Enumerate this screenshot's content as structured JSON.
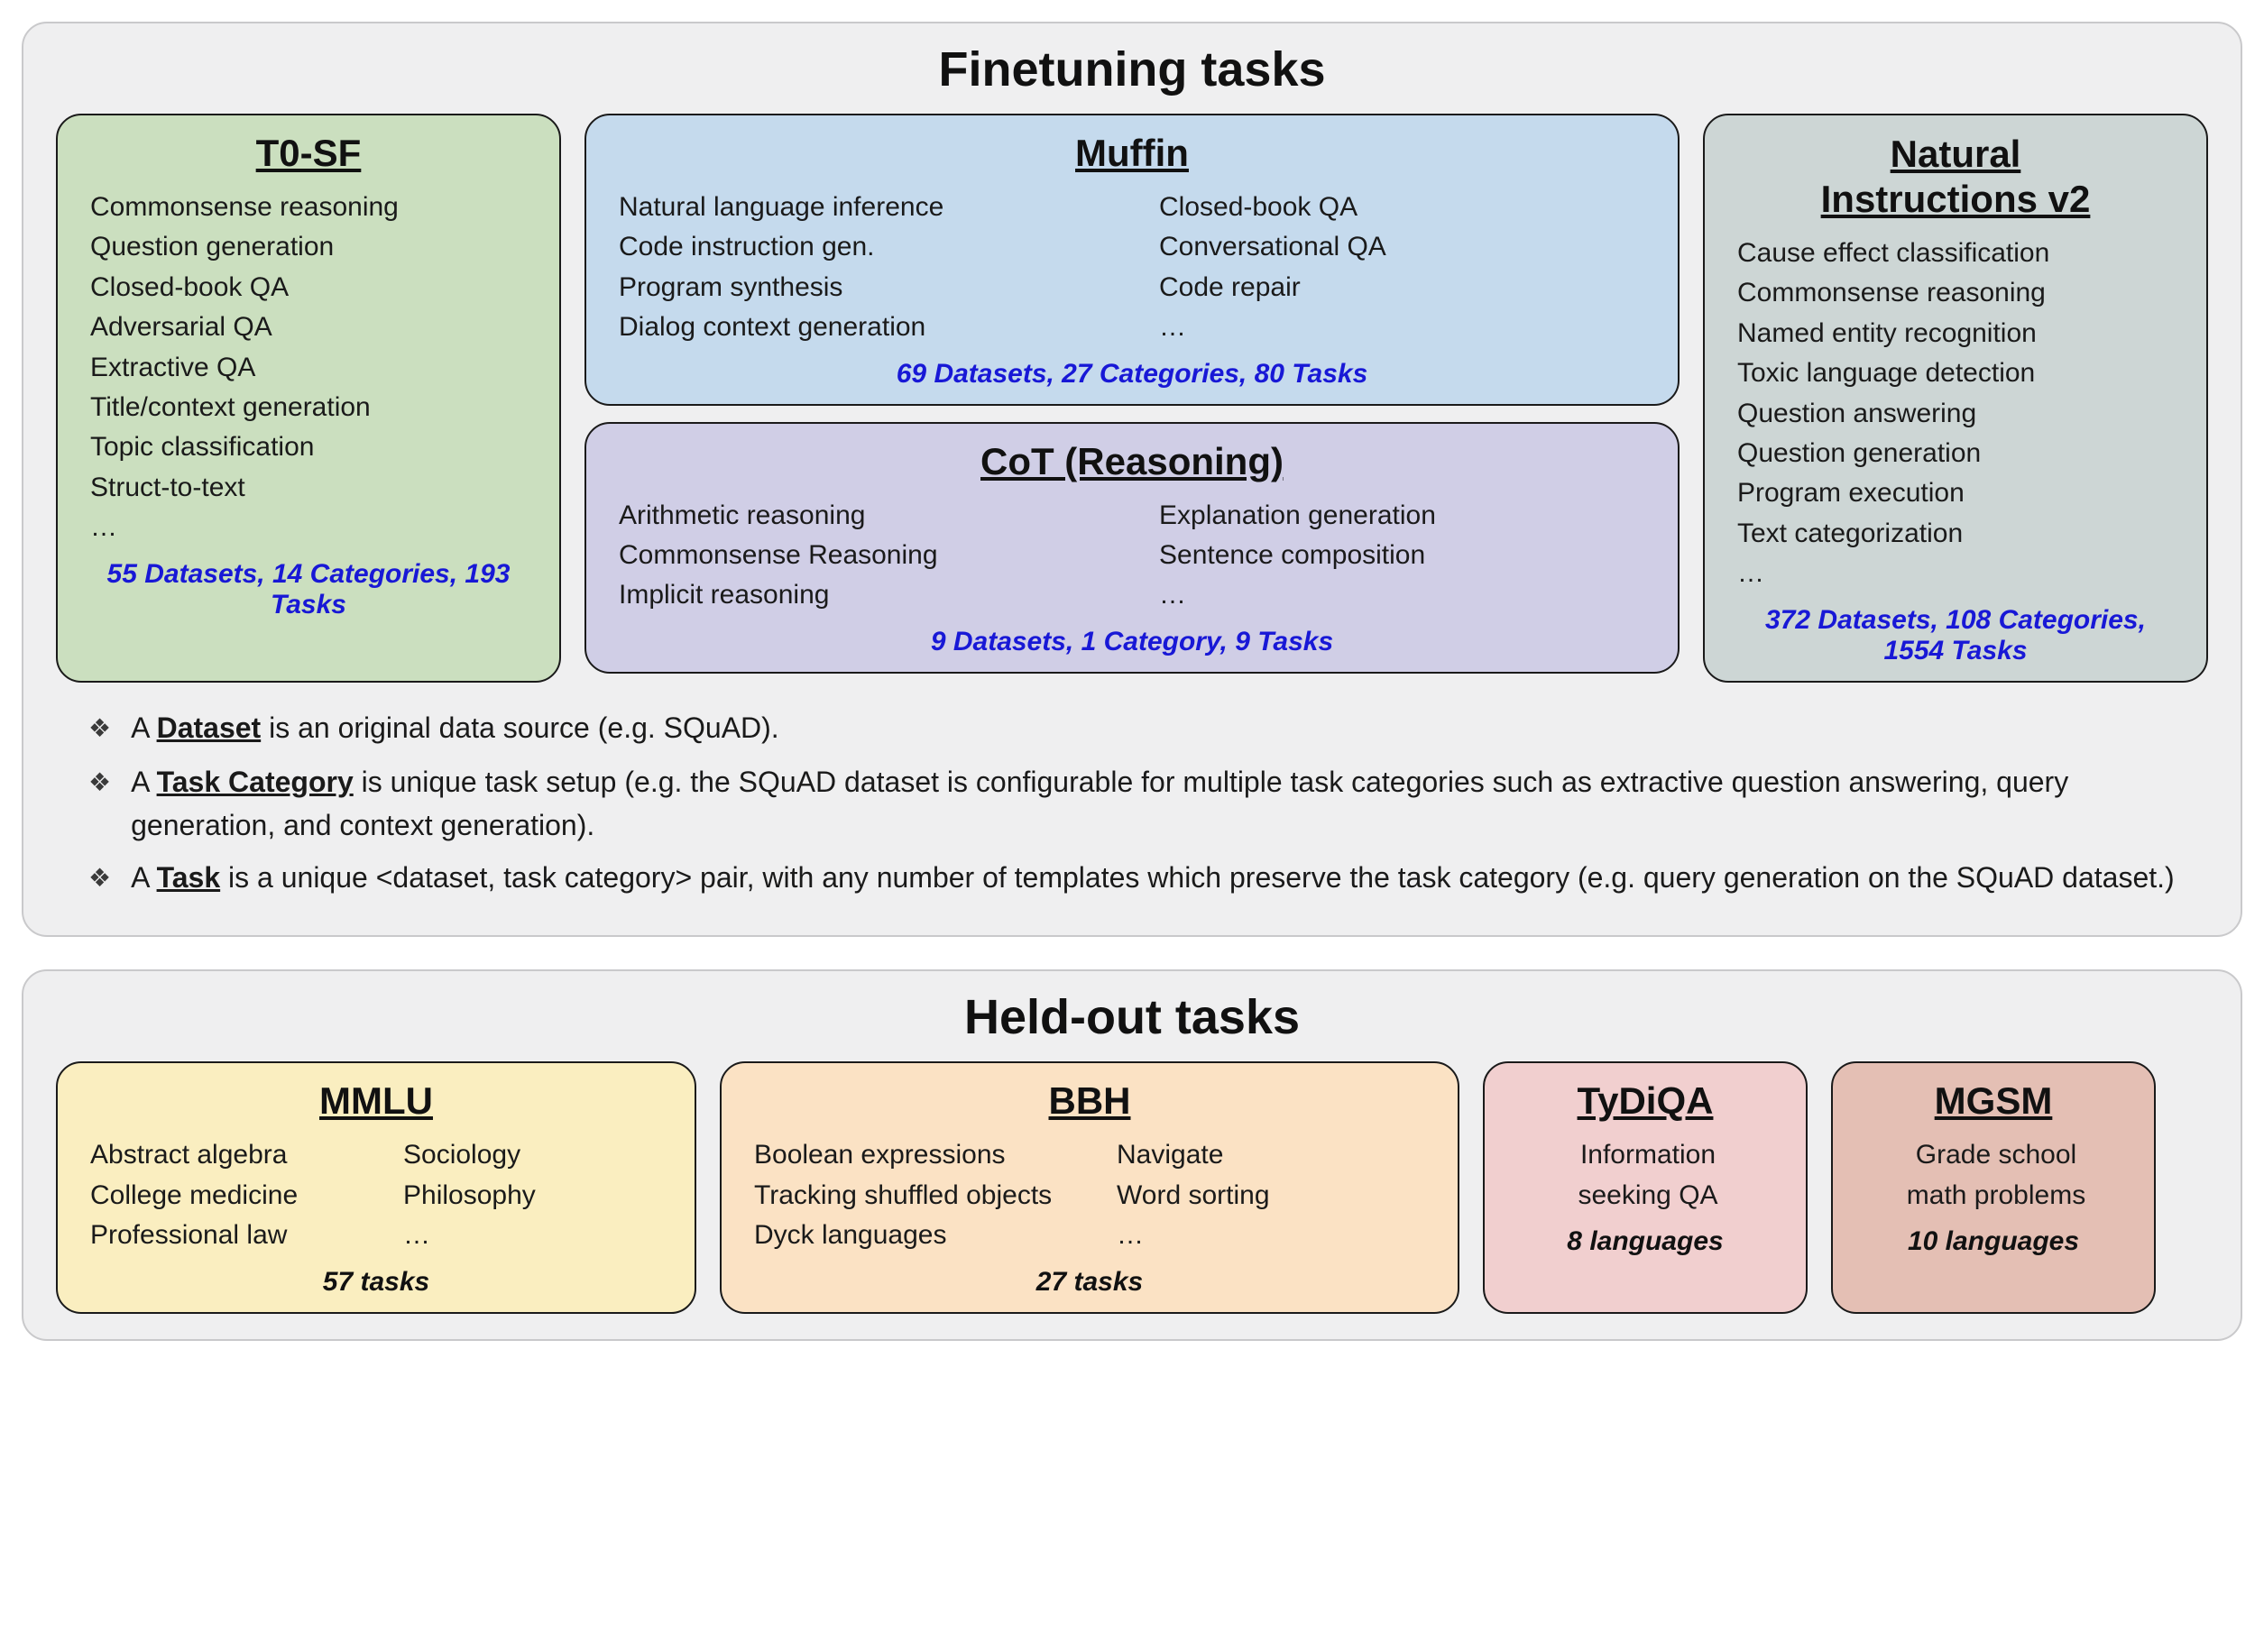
{
  "finetuning": {
    "title": "Finetuning tasks",
    "t0sf": {
      "title": "T0-SF",
      "items": [
        "Commonsense reasoning",
        "Question generation",
        "Closed-book QA",
        "Adversarial QA",
        "Extractive QA",
        "Title/context generation",
        "Topic classification",
        "Struct-to-text",
        "…"
      ],
      "stats": "55 Datasets, 14 Categories, 193 Tasks"
    },
    "muffin": {
      "title": "Muffin",
      "left": [
        "Natural language inference",
        "Code instruction gen.",
        "Program synthesis",
        "Dialog context generation"
      ],
      "right": [
        "Closed-book QA",
        "Conversational QA",
        "Code repair",
        "…"
      ],
      "stats": "69 Datasets, 27 Categories, 80 Tasks"
    },
    "cot": {
      "title": "CoT (Reasoning)",
      "left": [
        "Arithmetic reasoning",
        "Commonsense Reasoning",
        "Implicit reasoning"
      ],
      "right": [
        "Explanation generation",
        "Sentence composition",
        "…"
      ],
      "stats": "9 Datasets, 1 Category, 9 Tasks"
    },
    "ni": {
      "title_l1": "Natural",
      "title_l2": "Instructions v2",
      "items": [
        "Cause effect classification",
        "Commonsense reasoning",
        "Named entity recognition",
        "Toxic language detection",
        "Question answering",
        "Question generation",
        "Program execution",
        "Text categorization",
        "…"
      ],
      "stats": "372 Datasets, 108 Categories, 1554 Tasks"
    },
    "defs": {
      "d1_pre": "A ",
      "d1_term": "Dataset",
      "d1_post": " is an original data source (e.g. SQuAD).",
      "d2_pre": "A ",
      "d2_term": "Task Category",
      "d2_post": " is unique task setup (e.g. the SQuAD dataset is configurable for multiple task categories such as extractive question answering, query generation, and context generation).",
      "d3_pre": "A ",
      "d3_term": "Task",
      "d3_post": " is a unique <dataset, task category> pair, with any number of templates which preserve the task category (e.g. query generation on the SQuAD dataset.)"
    }
  },
  "heldout": {
    "title": "Held-out tasks",
    "mmlu": {
      "title": "MMLU",
      "left": [
        "Abstract algebra",
        "College medicine",
        "Professional law"
      ],
      "right": [
        "Sociology",
        "Philosophy",
        "…"
      ],
      "stats": "57 tasks"
    },
    "bbh": {
      "title": "BBH",
      "left": [
        "Boolean expressions",
        "Tracking shuffled objects",
        "Dyck languages"
      ],
      "right": [
        "Navigate",
        "Word sorting",
        "…"
      ],
      "stats": "27 tasks"
    },
    "tydi": {
      "title": "TyDiQA",
      "items": [
        "Information",
        "seeking QA"
      ],
      "stats": "8 languages"
    },
    "mgsm": {
      "title": "MGSM",
      "items": [
        "Grade school",
        "math problems"
      ],
      "stats": "10 languages"
    }
  }
}
